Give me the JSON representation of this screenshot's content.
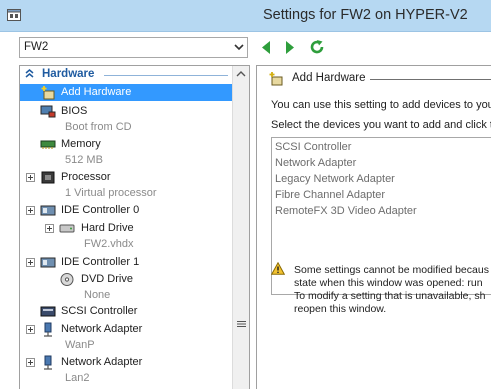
{
  "window": {
    "title": "Settings for FW2 on HYPER-V2",
    "icon": "settings-app-icon"
  },
  "toolbar": {
    "vm_selected": "FW2",
    "back_icon": "green-left-arrow",
    "forward_icon": "green-right-arrow",
    "refresh_icon": "green-refresh-icon"
  },
  "tree": {
    "section_label": "Hardware",
    "items": [
      {
        "label": "Add Hardware",
        "icon": "add-hardware-icon",
        "selected": true
      },
      {
        "label": "BIOS",
        "sublabel": "Boot from CD",
        "icon": "bios-icon"
      },
      {
        "label": "Memory",
        "sublabel": "512 MB",
        "icon": "memory-icon"
      },
      {
        "label": "Processor",
        "sublabel": "1 Virtual processor",
        "icon": "processor-icon",
        "expandable": true
      },
      {
        "label": "IDE Controller 0",
        "icon": "ide-controller-icon",
        "expandable": true
      },
      {
        "label": "Hard Drive",
        "sublabel": "FW2.vhdx",
        "icon": "hard-drive-icon",
        "expandable": true
      },
      {
        "label": "IDE Controller 1",
        "icon": "ide-controller-icon",
        "expandable": true
      },
      {
        "label": "DVD Drive",
        "sublabel": "None",
        "icon": "dvd-drive-icon"
      },
      {
        "label": "SCSI Controller",
        "icon": "scsi-controller-icon"
      },
      {
        "label": "Network Adapter",
        "sublabel": "WanP",
        "icon": "network-adapter-icon",
        "expandable": true
      },
      {
        "label": "Network Adapter",
        "sublabel": "Lan2",
        "icon": "network-adapter-icon",
        "expandable": true
      }
    ]
  },
  "panel": {
    "title": "Add Hardware",
    "intro": "You can use this setting to add devices to you",
    "instruction": "Select the devices you want to add and click t",
    "devices": [
      "SCSI Controller",
      "Network Adapter",
      "Legacy Network Adapter",
      "Fibre Channel Adapter",
      "RemoteFX 3D Video Adapter"
    ],
    "warning_lines": [
      "Some settings cannot be modified becaus",
      "state when this window was opened: run",
      "To modify a setting that is unavailable, sh",
      "reopen this window."
    ]
  },
  "colors": {
    "titlebar": "#b6d8f2",
    "selection": "#3399ff",
    "section_header": "#1f5ba0",
    "nav_green": "#2e9e3c"
  }
}
